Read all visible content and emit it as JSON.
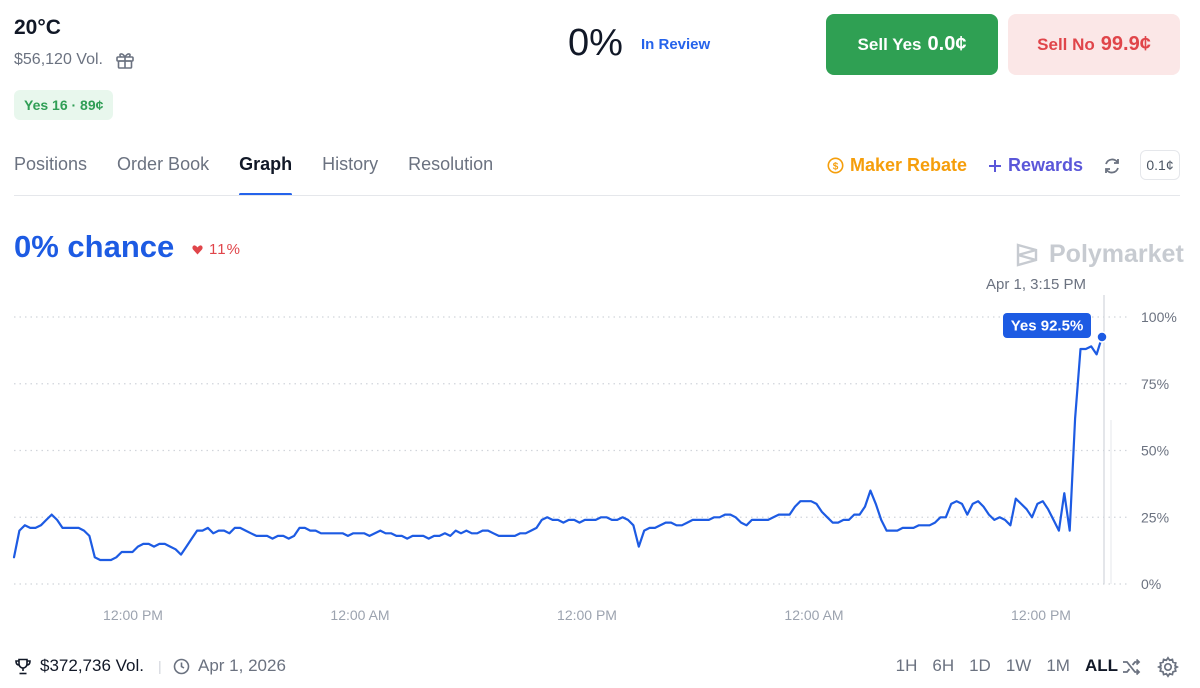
{
  "header": {
    "title": "20°C",
    "volume": "$56,120 Vol.",
    "pill": "Yes 16 · 89¢",
    "percent": "0%",
    "status": "In Review",
    "sell_yes_label": "Sell Yes",
    "sell_yes_price": "0.0¢",
    "sell_no_label": "Sell No",
    "sell_no_price": "99.9¢"
  },
  "tabs": [
    {
      "label": "Positions"
    },
    {
      "label": "Order Book"
    },
    {
      "label": "Graph",
      "active": true
    },
    {
      "label": "History"
    },
    {
      "label": "Resolution"
    }
  ],
  "toolbar": {
    "maker_rebate": "Maker Rebate",
    "rewards": "Rewards",
    "spread": "0.1¢"
  },
  "chart_header": {
    "chance": "0% chance",
    "delta": "11%",
    "watermark": "Polymarket"
  },
  "chart_data": {
    "type": "line",
    "hover_label": "Apr 1, 3:15 PM",
    "tooltip": "Yes 92.5%",
    "x_tick_labels": [
      "12:00 PM",
      "12:00 AM",
      "12:00 PM",
      "12:00 AM",
      "12:00 PM"
    ],
    "y_tick_labels": [
      "100%",
      "75%",
      "50%",
      "25%",
      "0%"
    ],
    "ylim": [
      0,
      100
    ],
    "grid": true,
    "line_color": "#1d5be3",
    "series": [
      {
        "values": [
          10,
          20,
          22,
          21,
          21,
          22,
          24,
          26,
          24,
          21,
          21,
          21,
          21,
          20,
          18,
          10,
          9,
          9,
          9,
          10,
          12,
          12,
          12,
          14,
          15,
          15,
          14,
          15,
          15,
          14,
          13,
          11,
          14,
          17,
          20,
          20,
          21,
          19,
          20,
          20,
          19,
          21,
          21,
          20,
          19,
          18,
          18,
          18,
          17,
          18,
          18,
          17,
          18,
          21,
          21,
          20,
          20,
          19,
          19,
          19,
          19,
          19,
          18,
          19,
          19,
          19,
          18,
          19,
          20,
          19,
          19,
          18,
          18,
          17,
          18,
          18,
          18,
          17,
          18,
          18,
          19,
          18,
          20,
          19,
          20,
          19,
          19,
          20,
          20,
          19,
          18,
          18,
          18,
          18,
          19,
          19,
          20,
          21,
          24,
          25,
          24,
          24,
          23,
          24,
          24,
          23,
          24,
          24,
          24,
          25,
          25,
          24,
          24,
          25,
          24,
          22,
          14,
          20,
          21,
          21,
          22,
          23,
          23,
          22,
          22,
          23,
          24,
          24,
          24,
          24,
          25,
          25,
          26,
          26,
          25,
          23,
          22,
          24,
          24,
          24,
          24,
          25,
          26,
          26,
          26,
          29,
          31,
          31,
          31,
          30,
          27,
          25,
          23,
          23,
          24,
          24,
          26,
          26,
          29,
          35,
          30,
          24,
          20,
          20,
          20,
          21,
          21,
          21,
          22,
          22,
          22,
          23,
          25,
          25,
          30,
          31,
          30,
          26,
          30,
          31,
          29,
          26,
          24,
          25,
          24,
          22,
          32,
          30,
          28,
          25,
          30,
          31,
          28,
          24,
          20,
          34,
          20,
          62,
          88,
          88,
          89,
          86,
          92.5
        ]
      }
    ]
  },
  "footer": {
    "volume": "$372,736 Vol.",
    "date": "Apr 1, 2026",
    "ranges": [
      {
        "label": "1H"
      },
      {
        "label": "6H"
      },
      {
        "label": "1D"
      },
      {
        "label": "1W"
      },
      {
        "label": "1M"
      },
      {
        "label": "ALL",
        "active": true
      }
    ]
  }
}
